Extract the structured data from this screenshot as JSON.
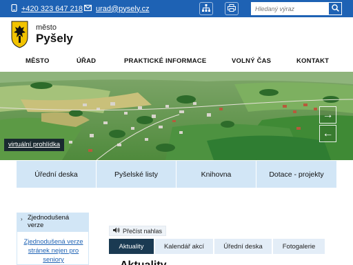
{
  "topbar": {
    "phone": "+420 323 647 218",
    "email": "urad@pysely.cz",
    "search_placeholder": "Hledaný výraz",
    "icons": [
      "phone-icon",
      "mail-icon",
      "sitemap-icon",
      "print-icon",
      "search-icon"
    ],
    "accent": "#1e62b4"
  },
  "header": {
    "subtitle": "město",
    "title": "Pyšely"
  },
  "nav": {
    "items": [
      "MĚSTO",
      "ÚŘAD",
      "PRAKTICKÉ INFORMACE",
      "VOLNÝ ČAS",
      "KONTAKT"
    ]
  },
  "hero": {
    "virtual_tour": "virtuální prohlídka",
    "next_label": "→",
    "prev_label": "←"
  },
  "tiles": [
    "Úřední deska",
    "Pyšelské listy",
    "Knihovna",
    "Dotace - projekty"
  ],
  "sidebar": {
    "heading": "Zjednodušená verze",
    "link": "Zjednodušená verze stránek nejen pro seniory"
  },
  "content": {
    "read_aloud": "Přečíst nahlas",
    "tabs": [
      "Aktuality",
      "Kalendář akcí",
      "Úřední deska",
      "Fotogalerie"
    ],
    "active_tab": "Aktuality",
    "heading": "Aktuality"
  },
  "colors": {
    "tile_bg": "#d2e6f6",
    "tab_active": "#1a3a52",
    "tab_bg": "#e3edf7"
  }
}
